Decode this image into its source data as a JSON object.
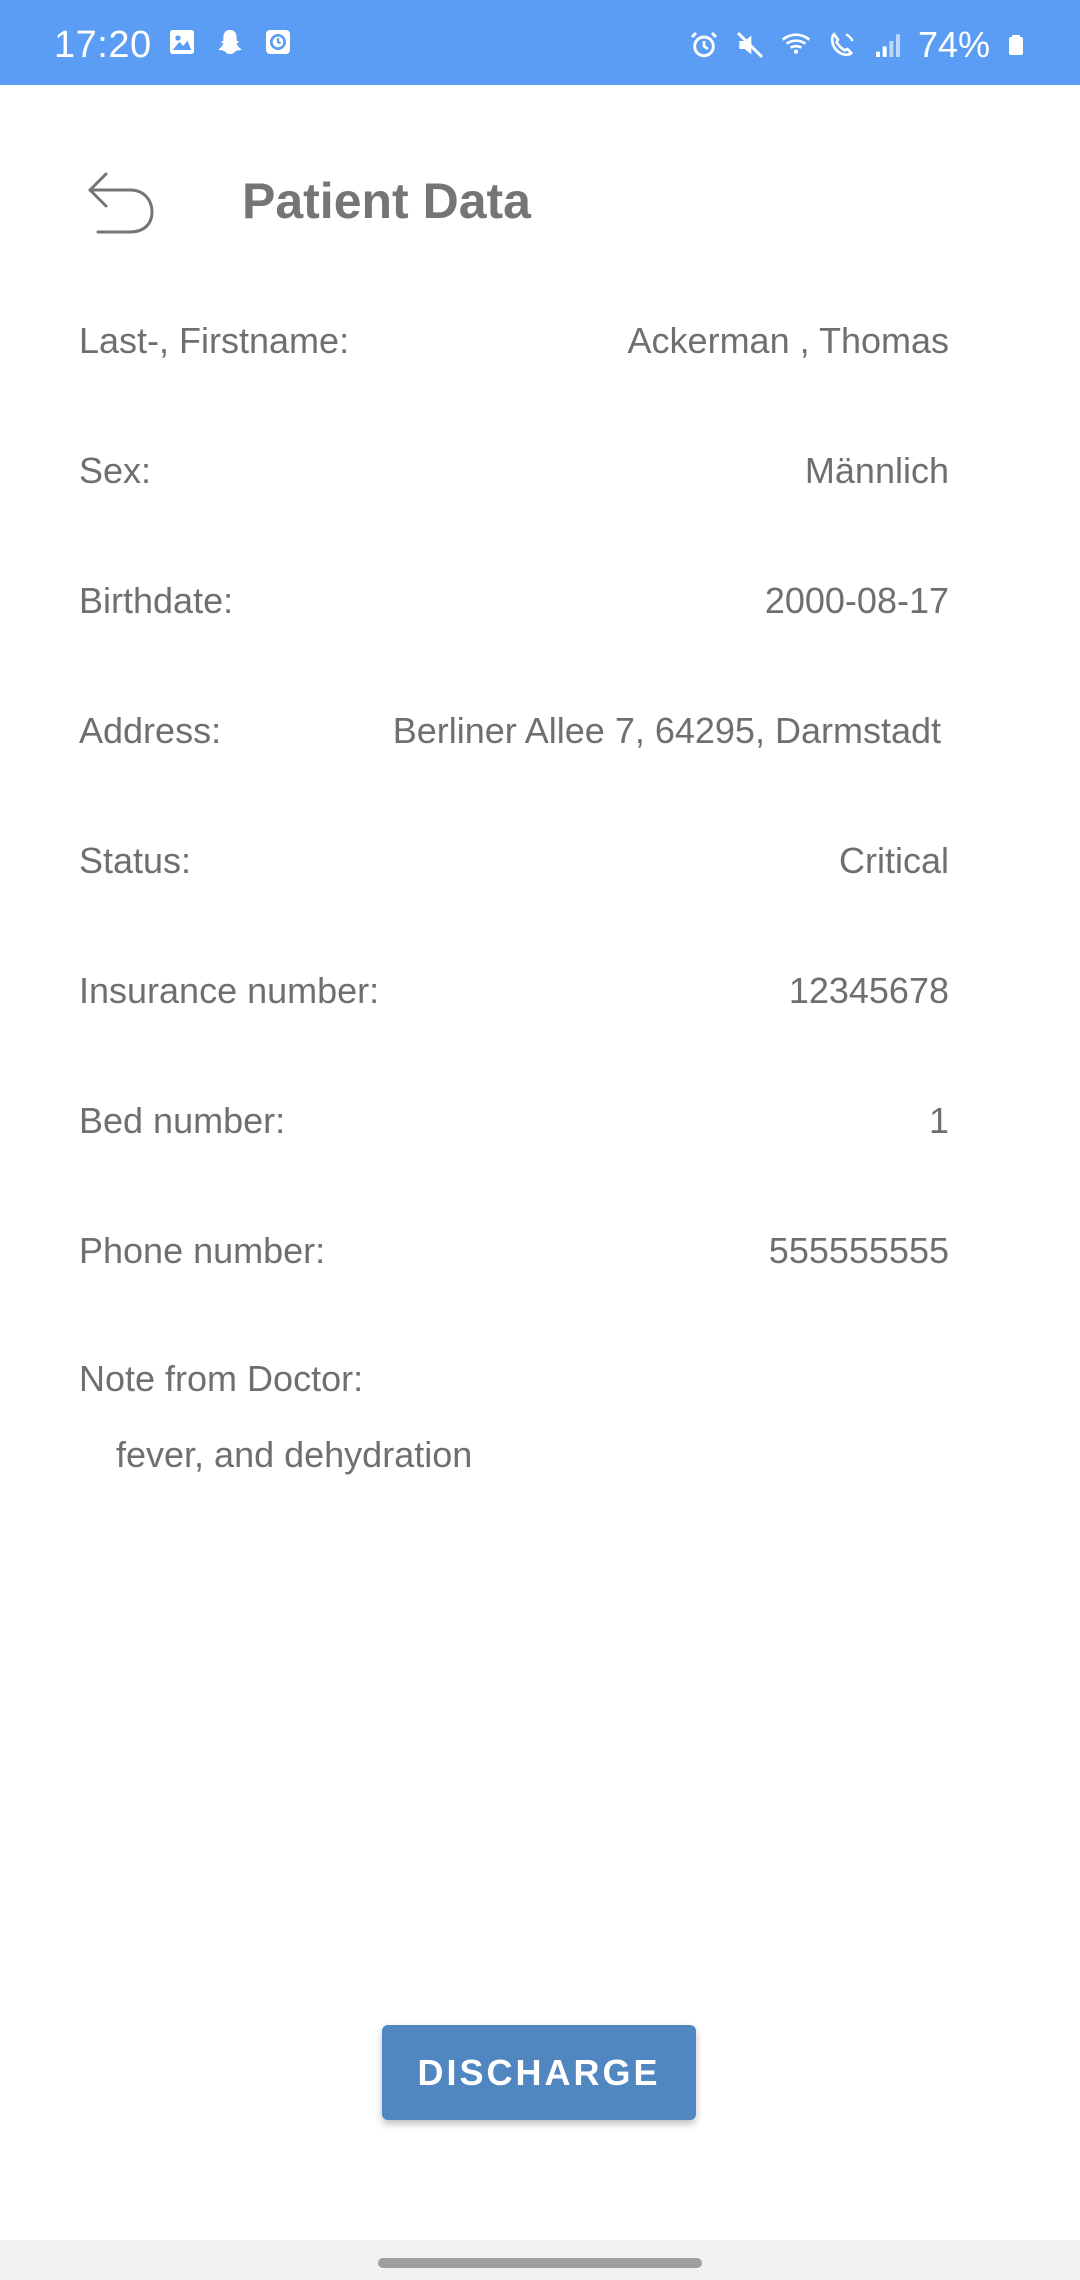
{
  "status_bar": {
    "time": "17:20",
    "battery": "74%",
    "left_icons": [
      "gallery-icon",
      "snapchat-icon",
      "clock-app-icon"
    ],
    "right_icons": [
      "alarm-icon",
      "mute-icon",
      "wifi-call-icon",
      "volte-icon",
      "signal-icon",
      "battery-icon"
    ],
    "background_color": "#5b9cf4"
  },
  "header": {
    "title": "Patient Data",
    "back_icon": "undo-arrow-icon"
  },
  "fields": [
    {
      "label": "Last-, Firstname:",
      "value": "Ackerman , Thomas"
    },
    {
      "label": "Sex:",
      "value": "Männlich"
    },
    {
      "label": "Birthdate:",
      "value": "2000-08-17"
    },
    {
      "label": "Address:",
      "value": "Berliner Allee 7, 64295, Darmstadt"
    },
    {
      "label": "Status:",
      "value": "Critical"
    },
    {
      "label": "Insurance number:",
      "value": "12345678"
    },
    {
      "label": "Bed number:",
      "value": "1"
    },
    {
      "label": "Phone number:",
      "value": "555555555"
    }
  ],
  "note": {
    "label": "Note from Doctor:",
    "text": "fever, and dehydration"
  },
  "actions": {
    "discharge_label": "DISCHARGE",
    "button_color": "#5187c0"
  }
}
